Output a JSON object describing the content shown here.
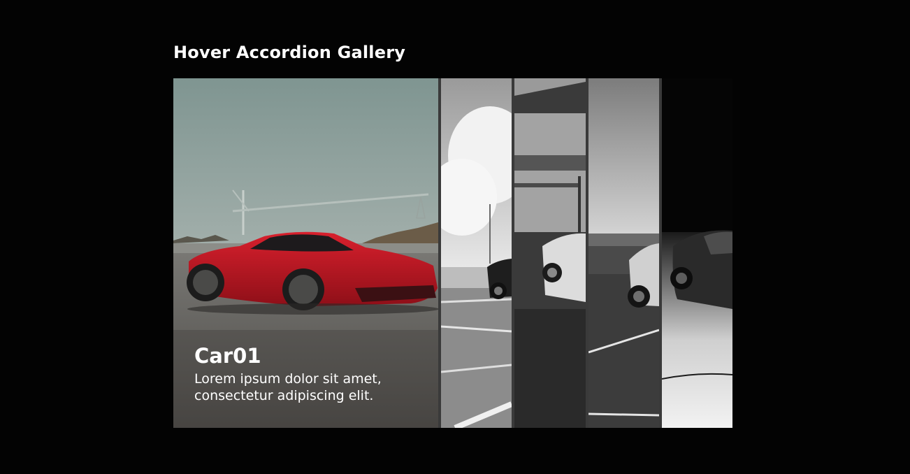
{
  "page": {
    "title": "Hover Accordion Gallery"
  },
  "gallery": {
    "panels": [
      {
        "image": "red-sports-car-photo",
        "caption_title": "Car01",
        "caption_text": "Lorem ipsum dolor sit amet, consectetur adipiscing elit.",
        "active": true
      },
      {
        "image": "bw-car-parking-clouds-photo",
        "active": false
      },
      {
        "image": "bw-white-supercar-garage-photo",
        "active": false
      },
      {
        "image": "bw-car-rooftop-sky-photo",
        "active": false
      },
      {
        "image": "bw-dark-supercar-studio-photo",
        "active": false
      }
    ]
  }
}
